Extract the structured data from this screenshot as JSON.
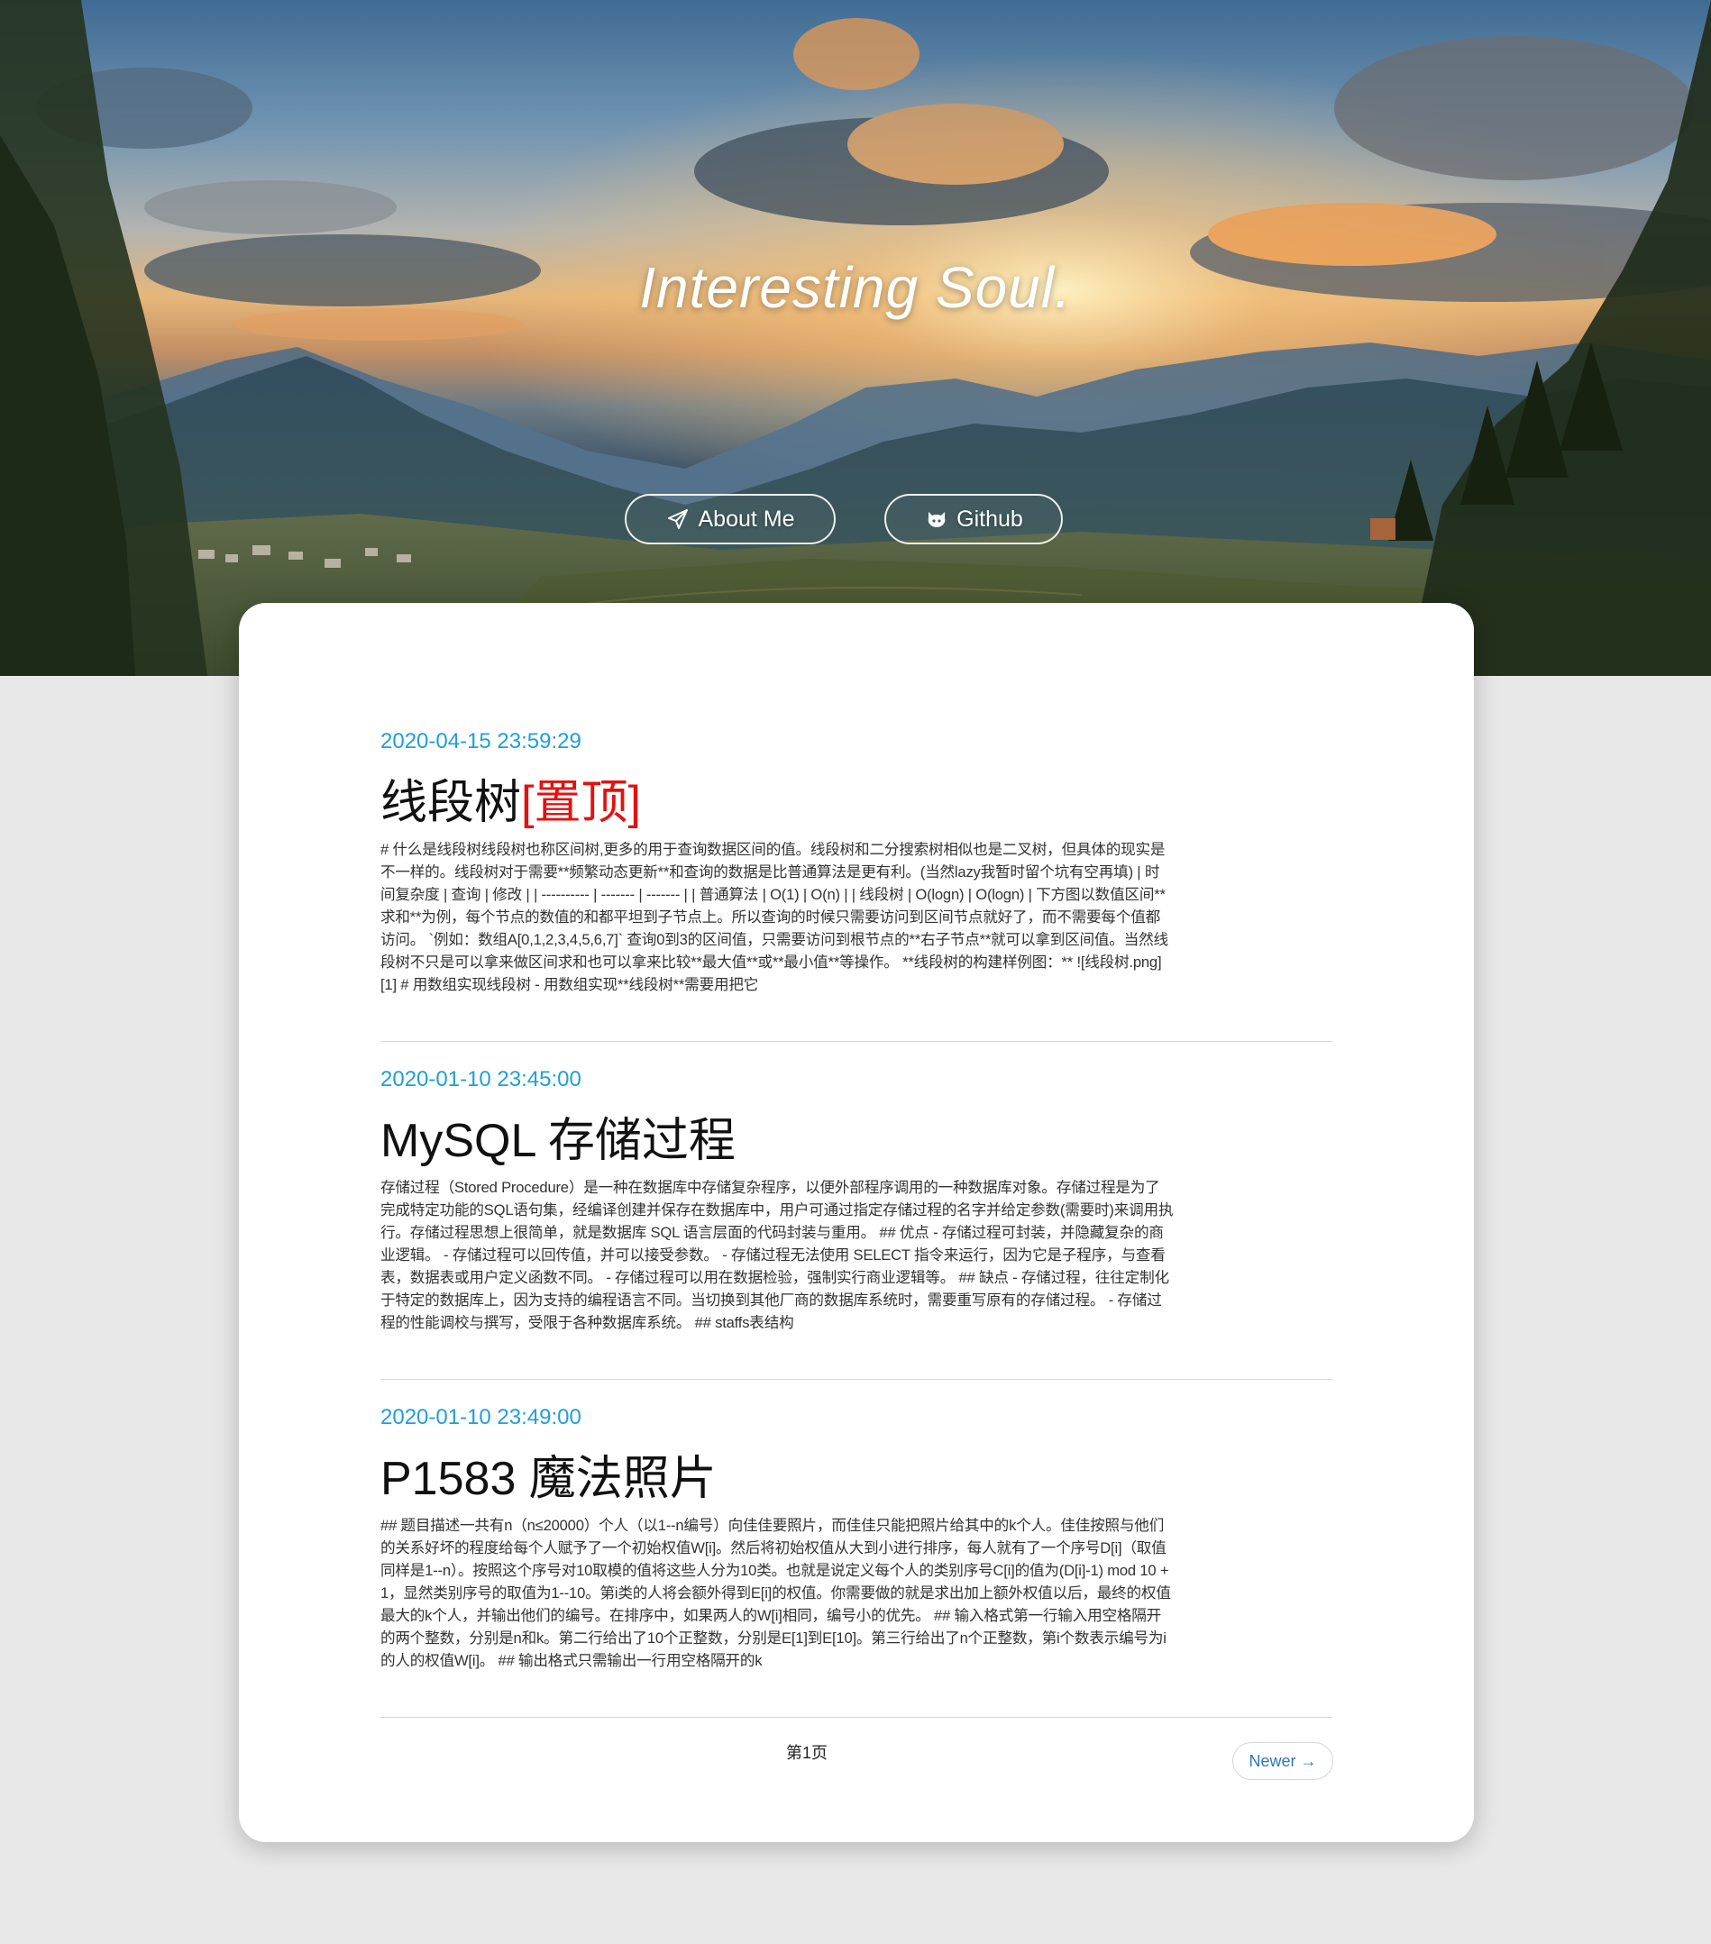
{
  "hero": {
    "title": "Interesting Soul.",
    "about_label": "About Me",
    "about_icon": "paper-plane-icon",
    "github_label": "Github",
    "github_icon": "github-octocat-icon"
  },
  "posts": [
    {
      "date": "2020-04-15 23:59:29",
      "title": "线段树",
      "pin": "[置顶]",
      "excerpt": "# 什么是线段树线段树也称区间树,更多的用于查询数据区间的值。线段树和二分搜索树相似也是二叉树，但具体的现实是不一样的。线段树对于需要**频繁动态更新**和查询的数据是比普通算法是更有利。(当然lazy我暂时留个坑有空再填) | 时间复杂度 | 查询 | 修改 | | ---------- | ------- | ------- | | 普通算法 | O(1) | O(n) | | 线段树 | O(logn) | O(logn) | 下方图以数值区间**求和**为例，每个节点的数值的和都平坦到子节点上。所以查询的时候只需要访问到区间节点就好了，而不需要每个值都访问。 `例如：数组A[0,1,2,3,4,5,6,7]` 查询0到3的区间值，只需要访问到根节点的**右子节点**就可以拿到区间值。当然线段树不只是可以拿来做区间求和也可以拿来比较**最大值**或**最小值**等操作。 **线段树的构建样例图：** ![线段树.png][1] # 用数组实现线段树 - 用数组实现**线段树**需要用把它"
    },
    {
      "date": "2020-01-10 23:45:00",
      "title": "MySQL 存储过程",
      "pin": "",
      "excerpt": "存储过程（Stored Procedure）是一种在数据库中存储复杂程序，以便外部程序调用的一种数据库对象。存储过程是为了完成特定功能的SQL语句集，经编译创建并保存在数据库中，用户可通过指定存储过程的名字并给定参数(需要时)来调用执行。存储过程思想上很简单，就是数据库 SQL 语言层面的代码封装与重用。 ## 优点 - 存储过程可封装，并隐藏复杂的商业逻辑。 - 存储过程可以回传值，并可以接受参数。 - 存储过程无法使用 SELECT 指令来运行，因为它是子程序，与查看表，数据表或用户定义函数不同。 - 存储过程可以用在数据检验，强制实行商业逻辑等。 ## 缺点 - 存储过程，往往定制化于特定的数据库上，因为支持的编程语言不同。当切换到其他厂商的数据库系统时，需要重写原有的存储过程。 - 存储过程的性能调校与撰写，受限于各种数据库系统。 ## staffs表结构"
    },
    {
      "date": "2020-01-10 23:49:00",
      "title": "P1583 魔法照片",
      "pin": "",
      "excerpt": "## 题目描述一共有n（n≤20000）个人（以1--n编号）向佳佳要照片，而佳佳只能把照片给其中的k个人。佳佳按照与他们的关系好坏的程度给每个人赋予了一个初始权值W[i]。然后将初始权值从大到小进行排序，每人就有了一个序号D[i]（取值同样是1--n）。按照这个序号对10取模的值将这些人分为10类。也就是说定义每个人的类别序号C[i]的值为(D[i]-1) mod 10 +1，显然类别序号的取值为1--10。第i类的人将会额外得到E[i]的权值。你需要做的就是求出加上额外权值以后，最终的权值最大的k个人，并输出他们的编号。在排序中，如果两人的W[i]相同，编号小的优先。 ## 输入格式第一行输入用空格隔开的两个整数，分别是n和k。第二行给出了10个正整数，分别是E[1]到E[10]。第三行给出了n个正整数，第i个数表示编号为i的人的权值W[i]。 ## 输出格式只需输出一行用空格隔开的k"
    }
  ],
  "pagination": {
    "page_label": "第1页",
    "newer_label": "Newer →"
  }
}
